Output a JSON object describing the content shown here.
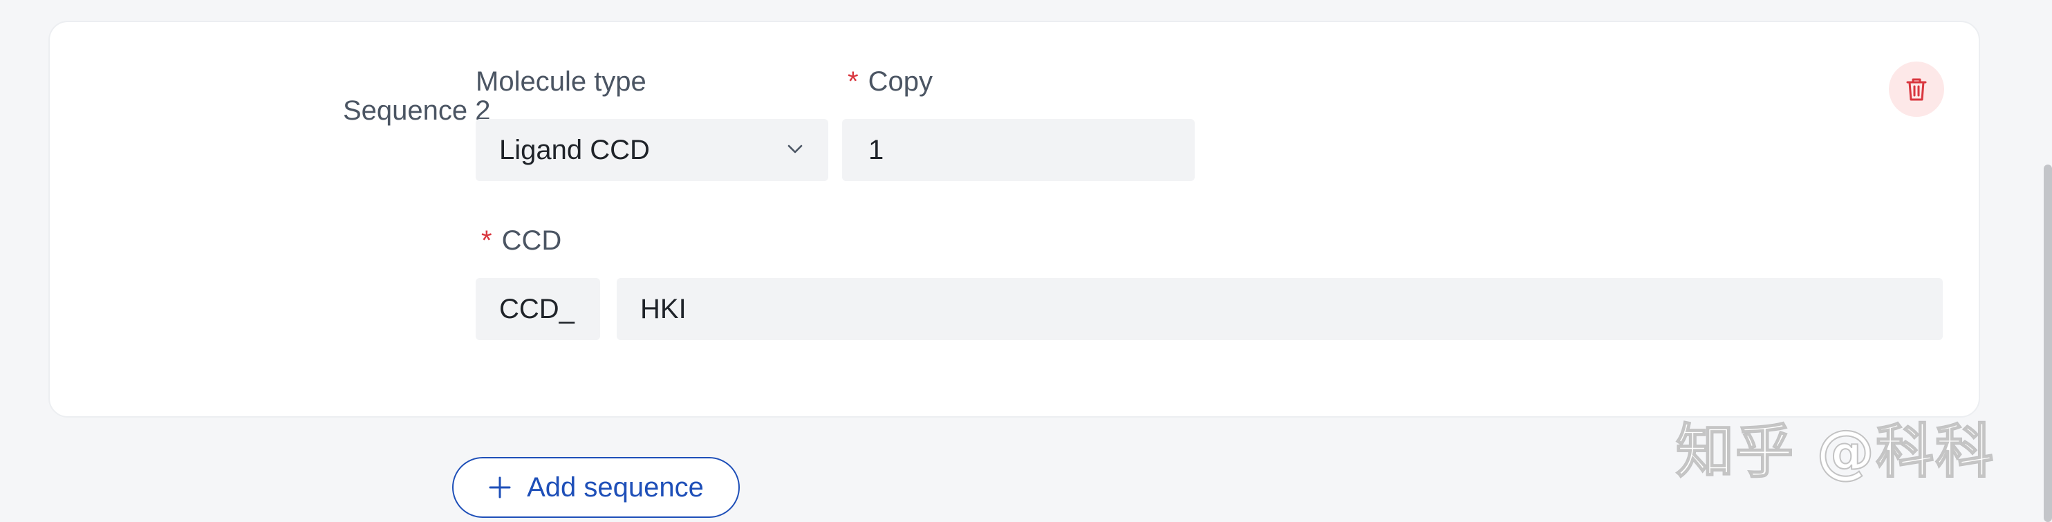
{
  "sequence": {
    "label": "Sequence 2",
    "molecule_type": {
      "label": "Molecule type",
      "selected": "Ligand CCD"
    },
    "copy": {
      "required_mark": "*",
      "label": "Copy",
      "value": "1"
    },
    "ccd": {
      "required_mark": "*",
      "label": "CCD",
      "prefix": "CCD_",
      "value": "HKI"
    },
    "delete_icon": "trash-icon"
  },
  "add_sequence": {
    "label": "Add sequence",
    "icon": "plus-icon"
  },
  "watermark": {
    "text": "知乎 @科科"
  },
  "colors": {
    "accent": "#1e4fb8",
    "danger": "#d9363e",
    "danger_bg": "#fde8e8",
    "field_bg": "#f2f3f5"
  }
}
